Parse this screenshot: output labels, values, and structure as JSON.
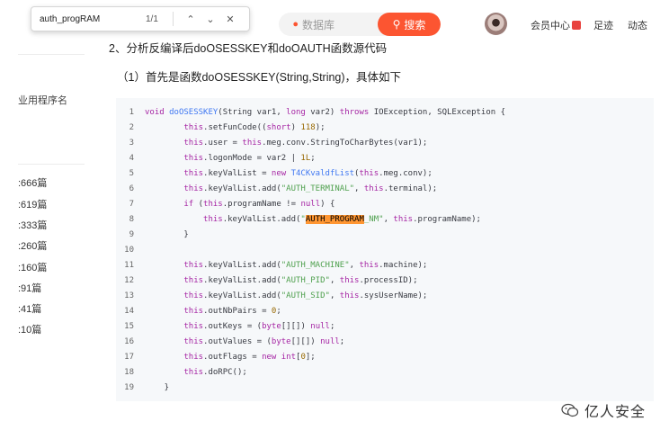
{
  "findbar": {
    "query": "auth_progRAM",
    "count": "1/1"
  },
  "header": {
    "search_placeholder": "数据库",
    "search_button": "搜索",
    "links": [
      "会员中心",
      "足迹",
      "动态"
    ]
  },
  "sidebar": {
    "title": "业用程序名",
    "items": [
      ":666篇",
      ":619篇",
      ":333篇",
      ":260篇",
      ":160篇",
      ":91篇",
      ":41篇",
      ":10篇"
    ]
  },
  "article": {
    "heading": "2、分析反编译后doOSESSKEY和doOAUTH函数源代码",
    "subheading": "（1）首先是函数doOSESSKEY(String,String)，具体如下"
  },
  "code": {
    "line_numbers": [
      "1",
      "2",
      "3",
      "4",
      "5",
      "6",
      "7",
      "8",
      "9",
      "10",
      "11",
      "12",
      "13",
      "14",
      "15",
      "16",
      "17",
      "18",
      "19"
    ]
  },
  "watermark": "亿人安全",
  "colors": {
    "accent": "#fc5531",
    "code_bg": "#f6f8fa",
    "keyword": "#a626a4",
    "function": "#4078f2",
    "string": "#50a14f",
    "number": "#986801",
    "highlight": "#ff9632"
  }
}
